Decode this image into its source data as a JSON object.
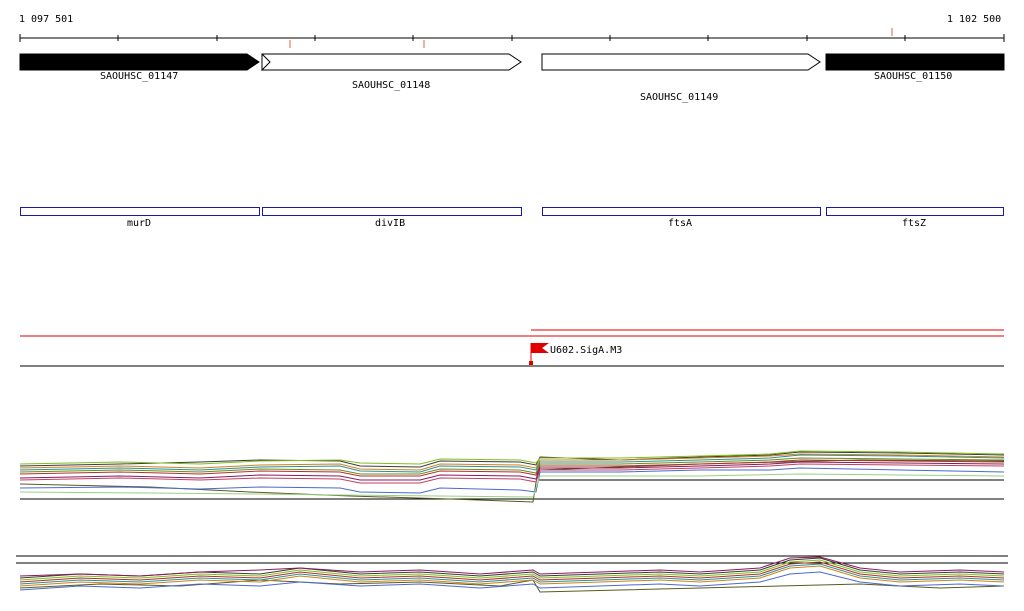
{
  "ruler": {
    "start_label": "1 097 501",
    "end_label": "1 102 500"
  },
  "loci": [
    {
      "label": "SAOUHSC_01147",
      "strand": "+",
      "filled": true
    },
    {
      "label": "SAOUHSC_01148",
      "strand": "+",
      "filled": false
    },
    {
      "label": "SAOUHSC_01149",
      "strand": "+",
      "filled": false
    },
    {
      "label": "SAOUHSC_01150",
      "strand": "+",
      "filled": true
    }
  ],
  "genes": [
    {
      "label": "murD"
    },
    {
      "label": "divIB"
    },
    {
      "label": "ftsA"
    },
    {
      "label": "ftsZ"
    }
  ],
  "promoter": {
    "label": "U602.SigA.M3"
  },
  "colors": {
    "gene_box_border": "#1a1aa6",
    "promoter_flag": "#e00000",
    "operon_line": "#e00000",
    "axis": "#000000"
  },
  "tracks": [
    {
      "name": "expression-profiles-upper",
      "type": "line-bundle"
    },
    {
      "name": "expression-profiles-lower",
      "type": "line-bundle"
    }
  ]
}
